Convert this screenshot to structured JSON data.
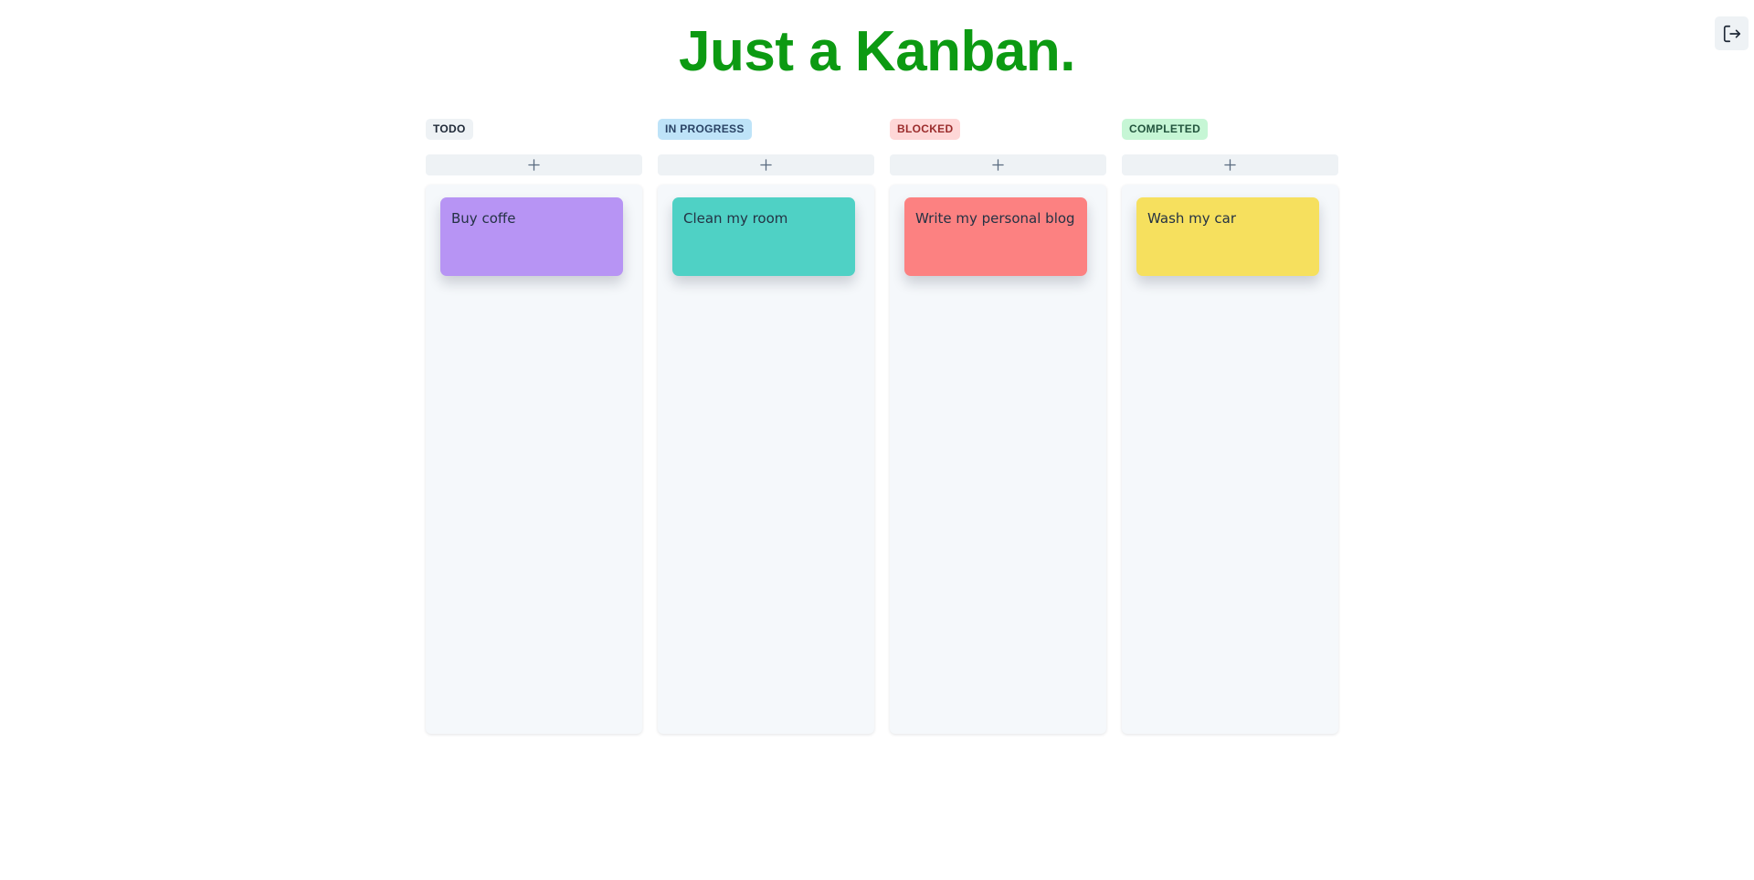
{
  "header": {
    "title": "Just a Kanban.",
    "title_color": "#0c9a12",
    "logout_icon": "logout-icon"
  },
  "columns": [
    {
      "label": "TODO",
      "badge_bg": "#eef2f5",
      "badge_fg": "#1f2937",
      "add_icon": "plus-icon",
      "cards": [
        {
          "text": "Buy coffe",
          "color": "#b794f4"
        }
      ]
    },
    {
      "label": "IN PROGRESS",
      "badge_bg": "#bee3f8",
      "badge_fg": "#2a4365",
      "add_icon": "plus-icon",
      "cards": [
        {
          "text": "Clean my room",
          "color": "#4fd1c5"
        }
      ]
    },
    {
      "label": "BLOCKED",
      "badge_bg": "#fed7d7",
      "badge_fg": "#9b2c2c",
      "add_icon": "plus-icon",
      "cards": [
        {
          "text": "Write my personal blog",
          "color": "#fc8181"
        }
      ]
    },
    {
      "label": "COMPLETED",
      "badge_bg": "#c6f6d5",
      "badge_fg": "#22543d",
      "add_icon": "plus-icon",
      "cards": [
        {
          "text": "Wash my car",
          "color": "#f6e05e"
        }
      ]
    }
  ]
}
